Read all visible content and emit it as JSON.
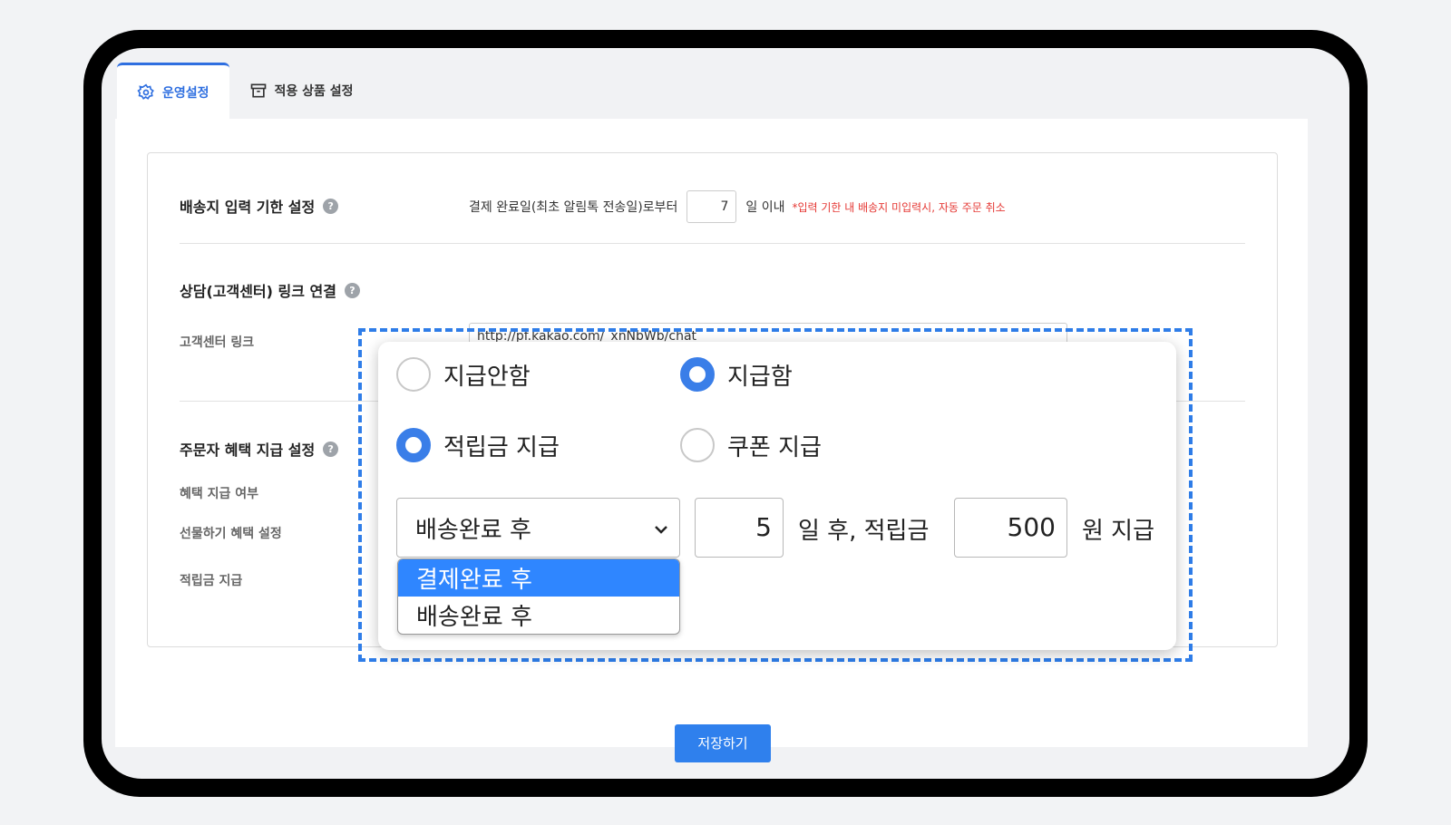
{
  "tabs": [
    {
      "label": "운영설정",
      "icon": "gear-icon",
      "active": true
    },
    {
      "label": "적용 상품 설정",
      "icon": "archive-box-icon",
      "active": false
    }
  ],
  "shipping_deadline": {
    "title": "배송지 입력 기한 설정",
    "help": "?",
    "prefix": "결제 완료일(최초 알림톡 전송일)로부터",
    "days": "7",
    "suffix": "일 이내",
    "warning": "*입력 기한 내 배송지 미입력시, 자동 주문 취소"
  },
  "consult_link": {
    "title": "상담(고객센터) 링크 연결",
    "help": "?",
    "label": "고객센터 링크",
    "value": "http://pf.kakao.com/_xnNbWb/chat"
  },
  "benefit": {
    "title": "주문자 혜택 지급 설정",
    "help": "?",
    "labels": [
      "혜택 지급 여부",
      "선물하기 혜택 설정",
      "적립금 지급"
    ]
  },
  "zoom_panel": {
    "pay_options": [
      {
        "label": "지급안함",
        "selected": false
      },
      {
        "label": "지급함",
        "selected": true
      }
    ],
    "type_options": [
      {
        "label": "적립금 지급",
        "selected": true
      },
      {
        "label": "쿠폰 지급",
        "selected": false
      }
    ],
    "select_value": "배송완료 후",
    "days_value": "5",
    "days_label": "일 후, 적립금",
    "amount_value": "500",
    "amount_label": "원 지급",
    "dropdown_options": [
      {
        "label": "결제완료 후",
        "highlighted": true
      },
      {
        "label": "배송완료 후",
        "highlighted": false
      }
    ]
  },
  "save_button": "저장하기",
  "colors": {
    "accent": "#2f80ed",
    "warning": "#e53935",
    "highlight_box": "#2f7de8"
  }
}
